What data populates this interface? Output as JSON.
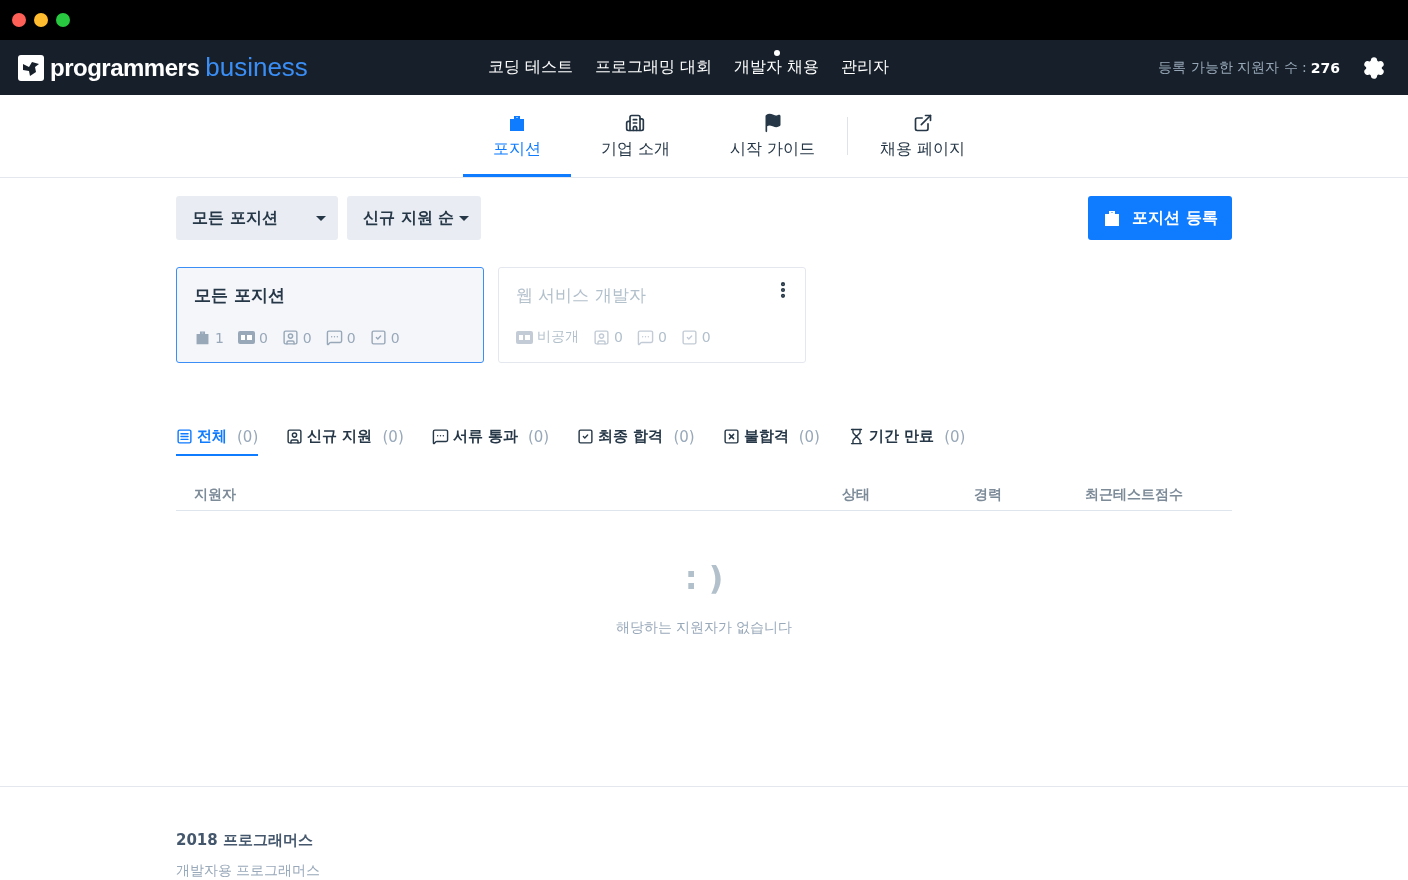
{
  "window": {
    "controls": [
      {
        "color": "#fe5f57"
      },
      {
        "color": "#febc2e"
      },
      {
        "color": "#28c840"
      }
    ]
  },
  "header": {
    "logo": {
      "primary": "programmers",
      "secondary": "business"
    },
    "nav": [
      {
        "label": "코딩 테스트",
        "dot": false
      },
      {
        "label": "프로그래밍 대회",
        "dot": false
      },
      {
        "label": "개발자 채용",
        "dot": true
      },
      {
        "label": "관리자",
        "dot": false
      }
    ],
    "quota_label": "등록 가능한 지원자 수 :",
    "quota_value": "276"
  },
  "subnav": [
    {
      "kind": "bag",
      "label": "포지션",
      "selected": true
    },
    {
      "kind": "building",
      "label": "기업 소개",
      "selected": false
    },
    {
      "kind": "flag",
      "label": "시작 가이드",
      "selected": false
    },
    {
      "kind": "external",
      "label": "채용 페이지",
      "selected": false
    }
  ],
  "filters": [
    {
      "label": "모든 포지션"
    },
    {
      "label": "신규 지원 순"
    }
  ],
  "register_button": {
    "label": "포지션 등록"
  },
  "position_cards": [
    {
      "title": "모든 포지션",
      "selected": true,
      "active": true,
      "menu": false,
      "stats": [
        {
          "kind": "bag",
          "value": "1"
        },
        {
          "kind": "onoff",
          "value": "0"
        },
        {
          "kind": "person",
          "value": "0"
        },
        {
          "kind": "comment",
          "value": "0"
        },
        {
          "kind": "check",
          "value": "0"
        }
      ]
    },
    {
      "title": "웹 서비스 개발자",
      "selected": false,
      "active": false,
      "menu": true,
      "stats": [
        {
          "kind": "onoff",
          "value": "비공개"
        },
        {
          "kind": "person",
          "value": "0"
        },
        {
          "kind": "comment",
          "value": "0"
        },
        {
          "kind": "check",
          "value": "0"
        }
      ]
    }
  ],
  "status_tabs": [
    {
      "kind": "list",
      "label": "전체",
      "count": "(0)",
      "selected": true
    },
    {
      "kind": "person",
      "label": "신규 지원",
      "count": "(0)",
      "selected": false
    },
    {
      "kind": "comment",
      "label": "서류 통과",
      "count": "(0)",
      "selected": false
    },
    {
      "kind": "check",
      "label": "최종 합격",
      "count": "(0)",
      "selected": false
    },
    {
      "kind": "cross",
      "label": "불합격",
      "count": "(0)",
      "selected": false
    },
    {
      "kind": "hourglass",
      "label": "기간 만료",
      "count": "(0)",
      "selected": false
    }
  ],
  "table": {
    "columns": [
      "지원자",
      "상태",
      "경력",
      "최근테스트점수"
    ]
  },
  "empty": {
    "face": ": )",
    "message": "해당하는 지원자가 없습니다"
  },
  "footer": {
    "title": "2018 프로그래머스",
    "subtitle": "개발자용 프로그래머스"
  }
}
